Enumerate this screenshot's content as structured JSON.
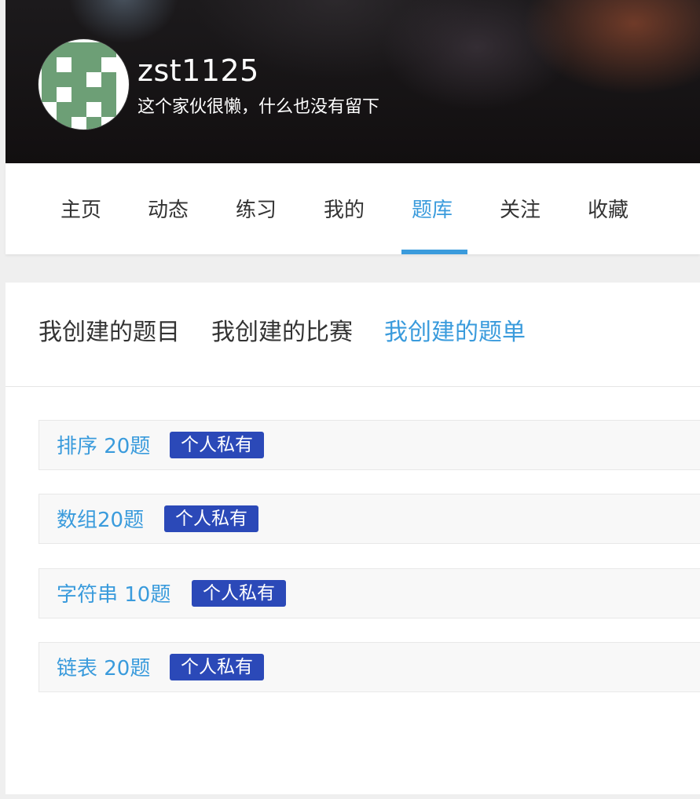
{
  "profile": {
    "username": "zst1125",
    "bio": "这个家伙很懒，什么也没有留下"
  },
  "nav": {
    "items": [
      {
        "label": "主页"
      },
      {
        "label": "动态"
      },
      {
        "label": "练习"
      },
      {
        "label": "我的"
      },
      {
        "label": "题库"
      },
      {
        "label": "关注"
      },
      {
        "label": "收藏"
      }
    ],
    "active": "题库"
  },
  "subtabs": {
    "items": [
      {
        "label": "我创建的题目"
      },
      {
        "label": "我创建的比赛"
      },
      {
        "label": "我创建的题单"
      }
    ],
    "active": "我创建的题单"
  },
  "problem_lists": [
    {
      "title": "排序 20题",
      "badge": "个人私有"
    },
    {
      "title": "数组20题",
      "badge": "个人私有"
    },
    {
      "title": "字符串 10题",
      "badge": "个人私有"
    },
    {
      "title": "链表 20题",
      "badge": "个人私有"
    }
  ],
  "colors": {
    "accent": "#3a9bdc",
    "badge": "#2b49b8",
    "avatar_green": "#6d9f76"
  }
}
